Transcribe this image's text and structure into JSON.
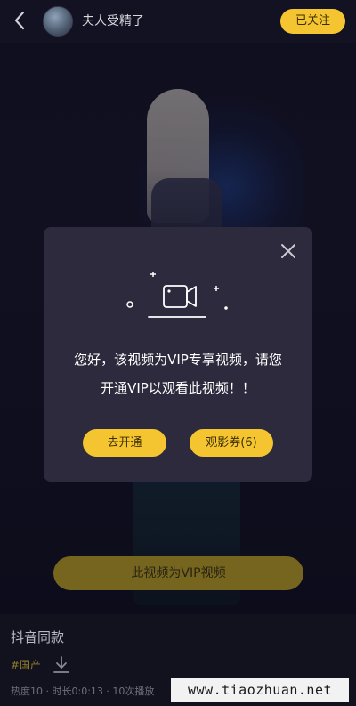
{
  "header": {
    "username": "夫人受精了",
    "follow_label": "已关注"
  },
  "modal": {
    "line1": "您好，该视频为VIP专享视频，请您",
    "line2": "开通VIP以观看此视频！！",
    "open_label": "去开通",
    "coupon_label": "观影券(6)"
  },
  "banner": {
    "label": "此视频为VIP视频"
  },
  "info": {
    "title": "抖音同款",
    "tag": "#国产",
    "stats": "热度10 · 时长0:0:13 · 10次播放"
  },
  "watermark": {
    "text": "www.tiaozhuan.net"
  },
  "icons": {
    "back": "chevron-left-icon",
    "close": "close-icon",
    "camera": "video-camera-icon",
    "download": "download-icon"
  },
  "colors": {
    "accent": "#f5c531",
    "modal_bg": "#2c2a3c",
    "banner": "#7b6a1f",
    "tag": "#8f7a2a"
  }
}
